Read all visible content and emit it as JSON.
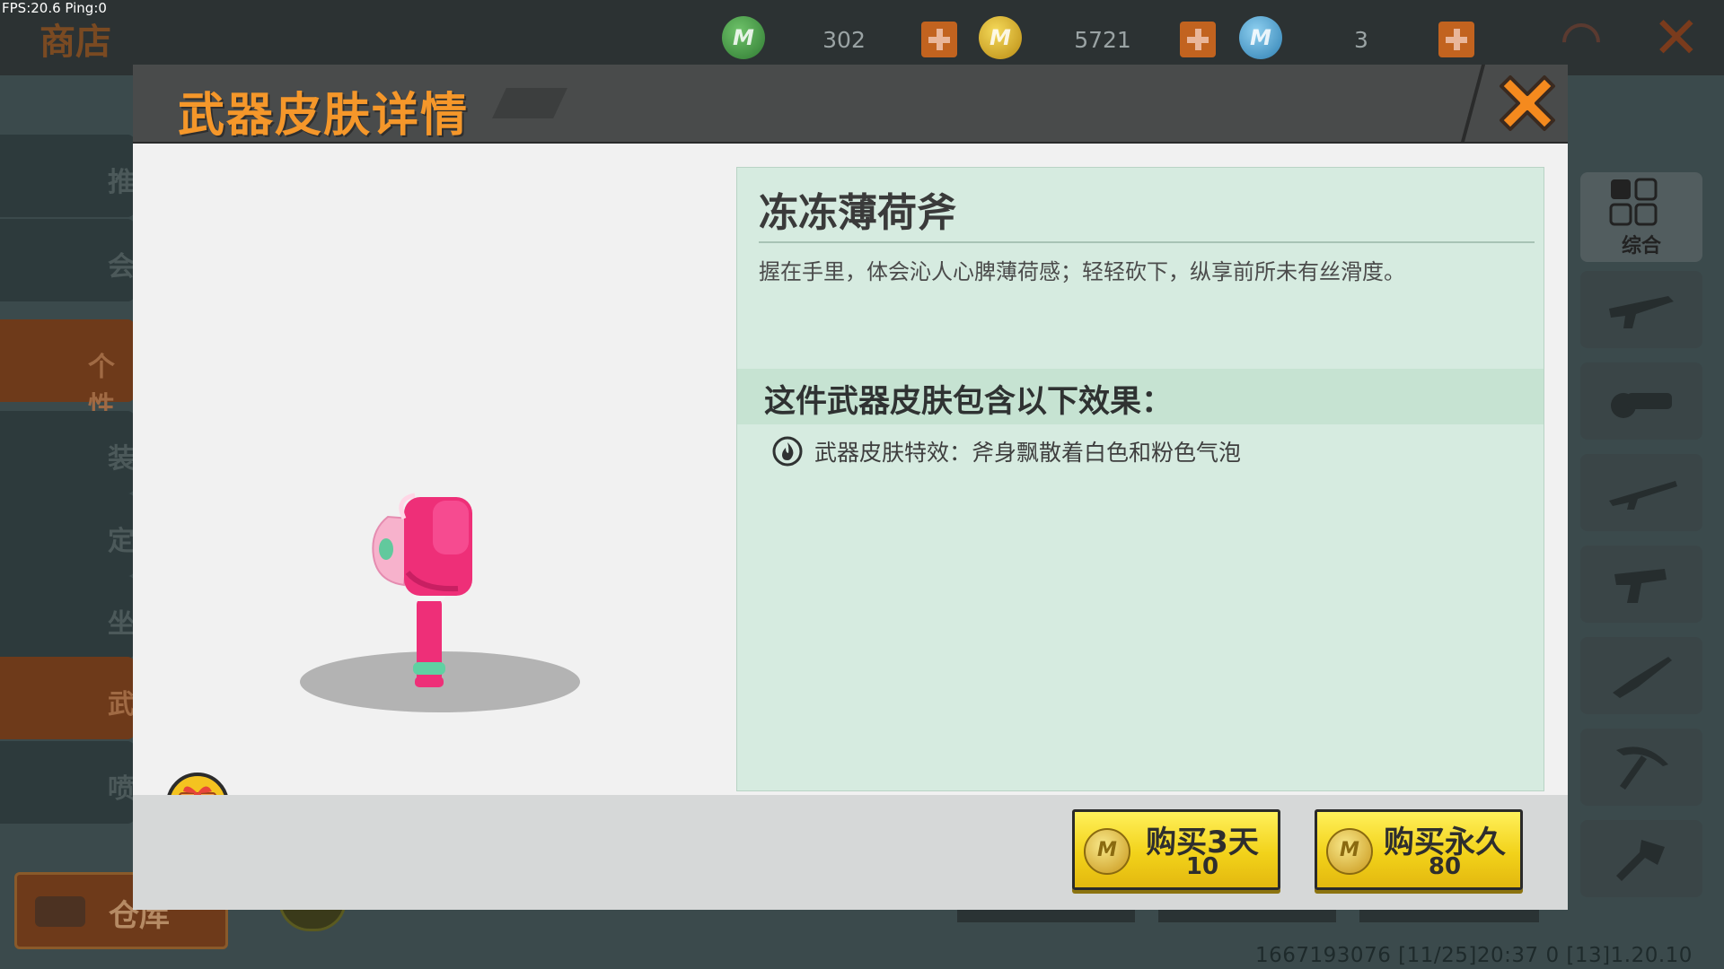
{
  "status": {
    "fps_text": "FPS:20.6  Ping:0"
  },
  "shop": {
    "title": "商店",
    "currencies": [
      {
        "icon": "green-gem-coin-icon",
        "value": "302"
      },
      {
        "icon": "gold-mini-coin-icon",
        "value": "5721"
      },
      {
        "icon": "blue-diamond-coin-icon",
        "value": "3"
      }
    ],
    "coin_letter": "M",
    "sidebar_partial_labels": [
      "推",
      "会",
      "个性",
      "装",
      "定",
      "坐",
      "武",
      "喷"
    ],
    "warehouse_label": "仓库",
    "category_label": "综合",
    "categories": [
      "all-grid-icon",
      "rifle-icon",
      "gatling-gun-icon",
      "sniper-rifle-icon",
      "revolver-icon",
      "knife-icon",
      "pickaxe-icon",
      "axe-icon"
    ],
    "footer_info": "1667193076   [11/25]20:37 0  [13]1.20.10"
  },
  "dialog": {
    "title": "武器皮肤详情",
    "item": {
      "name": "冻冻薄荷斧",
      "description": "握在手里，体会沁人心脾薄荷感；轻轻砍下，纵享前所未有丝滑度。",
      "effects_title": "这件武器皮肤包含以下效果：",
      "effects": [
        {
          "icon": "flame-icon",
          "text": "武器皮肤特效：斧身飘散着白色和粉色气泡"
        }
      ]
    },
    "buy_options": [
      {
        "label": "购买3天",
        "price": "10"
      },
      {
        "label": "购买永久",
        "price": "80"
      }
    ]
  },
  "colors": {
    "title_orange": "#f5972a",
    "close_orange": "#f58a1e",
    "panel_mint": "#d6ebe0",
    "button_yellow": "#f2d21a",
    "axe_pink": "#ee2f78",
    "axe_mint": "#5fd1a2"
  }
}
